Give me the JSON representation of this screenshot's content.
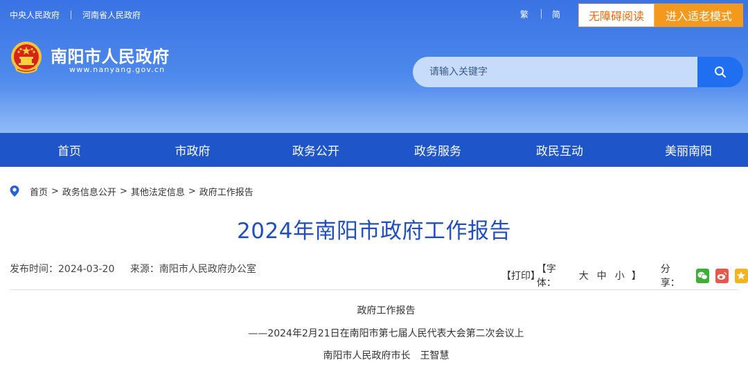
{
  "header": {
    "top_links": [
      "中央人民政府",
      "河南省人民政府"
    ],
    "lang_traditional": "繁",
    "lang_simplified": "简",
    "accessible_label": "无障碍阅读",
    "elder_mode_label": "进入适老模式",
    "site_name": "南阳市人民政府",
    "site_domain": "www.nanyang.gov.cn",
    "search_placeholder": "请输入关键字",
    "colors": {
      "header_blue": "#3a73e3",
      "nav_blue": "#1e56c9",
      "accent_orange": "#f39a1e",
      "title_blue": "#1f4fbf"
    }
  },
  "nav": {
    "items": [
      "首页",
      "市政府",
      "政务公开",
      "政务服务",
      "政民互动",
      "美丽南阳"
    ]
  },
  "breadcrumb": {
    "items": [
      "首页",
      "政务信息公开",
      "其他法定信息",
      "政府工作报告"
    ],
    "separator": ">"
  },
  "article": {
    "title": "2024年南阳市政府工作报告",
    "publish_time": "发布时间：2024-03-20",
    "source": "来源：南阳市人民政府办公室",
    "print_label": "【打印】",
    "font_label": "【字体：",
    "font_sizes": [
      "大",
      "中",
      "小"
    ],
    "font_close": "】",
    "share_label": "分享：",
    "share_icons": [
      "wechat-icon",
      "weibo-icon",
      "qzone-icon"
    ],
    "lines": [
      "政府工作报告",
      "——2024年2月21日在南阳市第七届人民代表大会第二次会议上",
      "南阳市人民政府市长　王智慧"
    ]
  }
}
